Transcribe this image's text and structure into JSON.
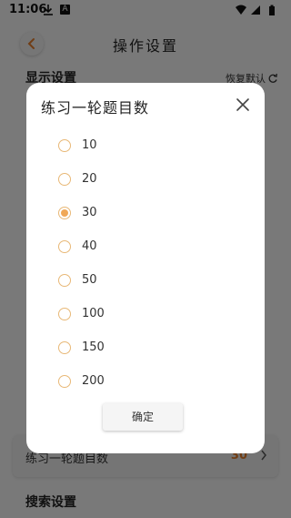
{
  "status_bar": {
    "time": "11:06",
    "icons": [
      "download-icon",
      "a-notification-icon",
      "wifi-icon",
      "cellular-icon",
      "battery-icon"
    ],
    "notification_letter": "A"
  },
  "header": {
    "title": "操作设置",
    "back_icon": "chevron-left-icon"
  },
  "page": {
    "display_section_title": "显示设置",
    "reset_label": "恢复默认",
    "reset_icon": "refresh-icon",
    "setting_item": {
      "label": "练习一轮题目数",
      "value": "30"
    },
    "search_section_title": "搜索设置"
  },
  "dialog": {
    "title": "练习一轮题目数",
    "close_icon": "close-icon",
    "options": [
      {
        "label": "10",
        "selected": false
      },
      {
        "label": "20",
        "selected": false
      },
      {
        "label": "30",
        "selected": true
      },
      {
        "label": "40",
        "selected": false
      },
      {
        "label": "50",
        "selected": false
      },
      {
        "label": "100",
        "selected": false
      },
      {
        "label": "150",
        "selected": false
      },
      {
        "label": "200",
        "selected": false
      }
    ],
    "confirm_label": "确定"
  },
  "colors": {
    "accent": "#f0a857",
    "radio_border": "#e8b877",
    "value_text": "#e07b2a"
  }
}
